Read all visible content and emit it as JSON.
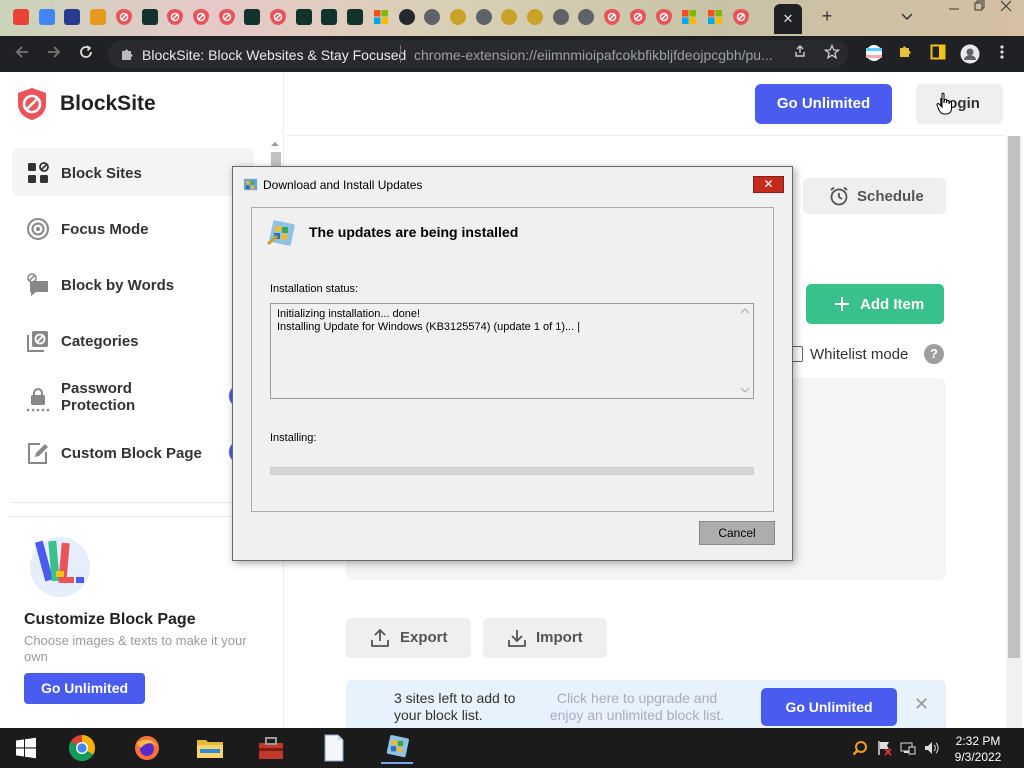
{
  "browser": {
    "tabs": [
      {
        "icon": "gmail-icon",
        "color": "#ea4335"
      },
      {
        "icon": "google-icon",
        "color": "#4285f4"
      },
      {
        "icon": "bookmark-icon",
        "color": "#2b3b8f"
      },
      {
        "icon": "ng-icon",
        "color": "#e69a1b"
      },
      {
        "icon": "blocksite-icon",
        "color": "#e8545a"
      },
      {
        "icon": "zendesk-icon",
        "color": "#12332b"
      },
      {
        "icon": "blocksite-icon",
        "color": "#e8545a"
      },
      {
        "icon": "blocksite-icon",
        "color": "#e8545a"
      },
      {
        "icon": "blocksite-icon",
        "color": "#e8545a"
      },
      {
        "icon": "zendesk-icon",
        "color": "#12332b"
      },
      {
        "icon": "blocksite-icon",
        "color": "#e8545a"
      },
      {
        "icon": "zendesk-icon",
        "color": "#12332b"
      },
      {
        "icon": "zendesk-icon",
        "color": "#12332b"
      },
      {
        "icon": "zendesk-icon",
        "color": "#12332b"
      },
      {
        "icon": "microsoft-icon",
        "color": "#f25022"
      },
      {
        "icon": "github-icon",
        "color": "#24292e"
      },
      {
        "icon": "chrome-icon",
        "color": "#5f6368"
      },
      {
        "icon": "coin-icon",
        "color": "#c9a227"
      },
      {
        "icon": "chrome-icon",
        "color": "#5f6368"
      },
      {
        "icon": "coin-icon",
        "color": "#c9a227"
      },
      {
        "icon": "coin-icon",
        "color": "#c9a227"
      },
      {
        "icon": "chrome-icon",
        "color": "#5f6368"
      },
      {
        "icon": "chrome-icon",
        "color": "#5f6368"
      },
      {
        "icon": "blocksite-icon",
        "color": "#e8545a"
      },
      {
        "icon": "blocksite-icon",
        "color": "#e8545a"
      },
      {
        "icon": "blocksite-icon",
        "color": "#e8545a"
      },
      {
        "icon": "microsoft-icon",
        "color": "#f25022"
      },
      {
        "icon": "microsoft-icon",
        "color": "#f25022"
      },
      {
        "icon": "blocksite-icon",
        "color": "#e8545a"
      }
    ],
    "active_tab_close": "✕",
    "new_tab": "+",
    "omnibox_title": "BlockSite: Block Websites & Stay Focused",
    "omnibox_url": "chrome-extension://eiimnmioipafcokbfikbljfdeojpcgbh/pu..."
  },
  "sidebar": {
    "brand": "BlockSite",
    "items": [
      {
        "label": "Block Sites",
        "icon": "grid-icon",
        "active": true
      },
      {
        "label": "Focus Mode",
        "icon": "target-icon"
      },
      {
        "label": "Block by Words",
        "icon": "chat-block-icon"
      },
      {
        "label": "Categories",
        "icon": "categories-icon"
      },
      {
        "label": "Password Protection",
        "line1": "Password",
        "line2": "Protection",
        "icon": "lock-dots-icon",
        "locked": true
      },
      {
        "label": "Custom Block Page",
        "icon": "edit-page-icon",
        "locked": true
      }
    ],
    "promo": {
      "title": "Customize Block Page",
      "description": "Choose images & texts to make it your own",
      "button": "Go Unlimited"
    }
  },
  "header": {
    "go_unlimited": "Go Unlimited",
    "login": "Login"
  },
  "main": {
    "schedule": "Schedule",
    "add_item": "Add Item",
    "whitelist": "Whitelist mode",
    "export": "Export",
    "import": "Import",
    "upgrade_bar": {
      "left": "3 sites left to add to your block list.",
      "middle": "Click here to upgrade and enjoy an unlimited block list.",
      "button": "Go Unlimited",
      "close": "✕"
    }
  },
  "dialog": {
    "title": "Download and Install Updates",
    "close": "✕",
    "heading": "The updates are being installed",
    "status_label": "Installation status:",
    "log_line1": "Initializing installation... done!",
    "log_line2": "Installing Update for Windows (KB3125574) (update 1 of 1)... |",
    "installing_label": "Installing:",
    "cancel": "Cancel"
  },
  "taskbar": {
    "time": "2:32 PM",
    "date": "9/3/2022"
  },
  "colors": {
    "accent": "#4a5bef",
    "green": "#38c18a",
    "brand_red": "#e8545a"
  }
}
